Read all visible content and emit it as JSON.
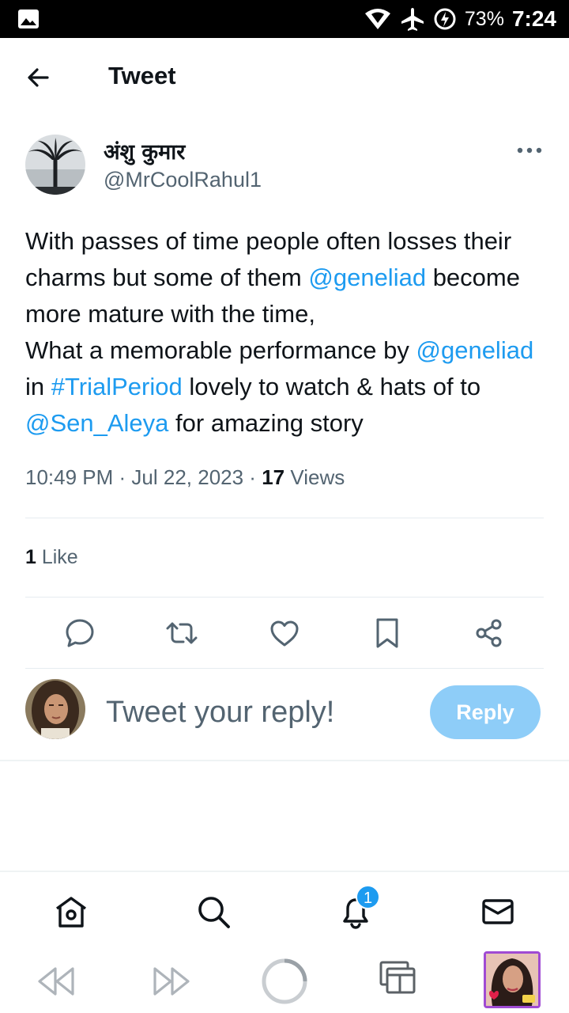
{
  "status_bar": {
    "battery": "73%",
    "time": "7:24"
  },
  "header": {
    "title": "Tweet"
  },
  "tweet": {
    "author_name": "अंशु कुमार",
    "author_handle": "@MrCoolRahul1",
    "text": {
      "p1": "With passes of time people often losses their charms but some of them ",
      "m1": "@geneliad",
      "p2": " become more mature with the time,",
      "p3": "What a memorable performance by ",
      "m2": "@geneliad",
      "p4": " in ",
      "h1": "#TrialPeriod",
      "p5": " lovely to watch & hats of to ",
      "m3": "@Sen_Aleya",
      "p6": " for amazing story"
    },
    "time": "10:49 PM",
    "sep1": " · ",
    "date": "Jul 22, 2023",
    "sep2": " · ",
    "views_count": "17",
    "views_label": " Views",
    "likes_count": "1",
    "likes_label": " Like"
  },
  "reply": {
    "placeholder": "Tweet your reply!",
    "button_label": "Reply"
  },
  "bottom_nav": {
    "notification_count": "1"
  },
  "colors": {
    "accent": "#1d9bf0",
    "reply_button_disabled": "#8ecdf8",
    "secondary_text": "#536471"
  },
  "icons": [
    "gallery-icon",
    "wifi-icon",
    "airplane-icon",
    "battery-charging-icon",
    "back-arrow-icon",
    "more-icon",
    "reply-icon",
    "retweet-icon",
    "like-icon",
    "bookmark-icon",
    "share-icon",
    "home-icon",
    "search-icon",
    "notifications-icon",
    "messages-icon",
    "rewind-icon",
    "fast-forward-icon",
    "loading-icon",
    "tabs-icon"
  ]
}
